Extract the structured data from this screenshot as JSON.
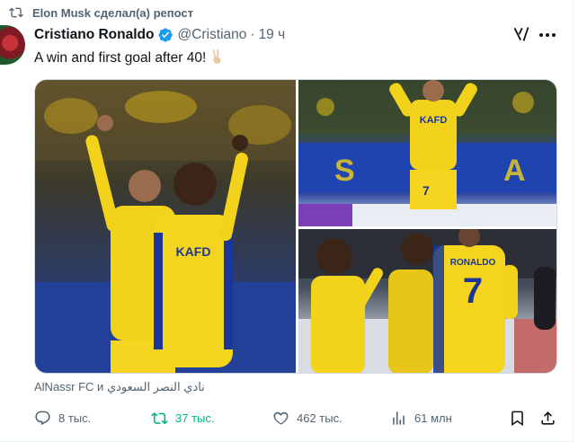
{
  "repost": {
    "label": "Elon Musk сделал(а) репост"
  },
  "author": {
    "name": "Cristiano Ronaldo",
    "handle": "@Cristiano",
    "dot": "·",
    "time": "19 ч"
  },
  "tweet": {
    "text": "A win and first goal after 40!",
    "emoji": "victory-hand-emoji"
  },
  "media_tags": "AlNassr FC и نادي النصر السعودي",
  "actions": {
    "replies": "8 тыс.",
    "reposts": "37 тыс.",
    "likes": "462 тыс.",
    "views": "61 млн"
  },
  "photo_text": {
    "jersey_name": "RONALDO",
    "jersey_number": "7",
    "sponsor": "KAFD"
  },
  "colors": {
    "accent_green": "#00ba7c",
    "muted": "#536471",
    "verified": "#1d9bf0",
    "kit_yellow": "#f2d21b",
    "kit_blue": "#1a3797"
  },
  "icons": [
    "repost-icon",
    "verified-badge-icon",
    "grok-icon",
    "more-icon",
    "reply-icon",
    "repost-icon",
    "like-icon",
    "views-icon",
    "bookmark-icon",
    "share-icon"
  ]
}
